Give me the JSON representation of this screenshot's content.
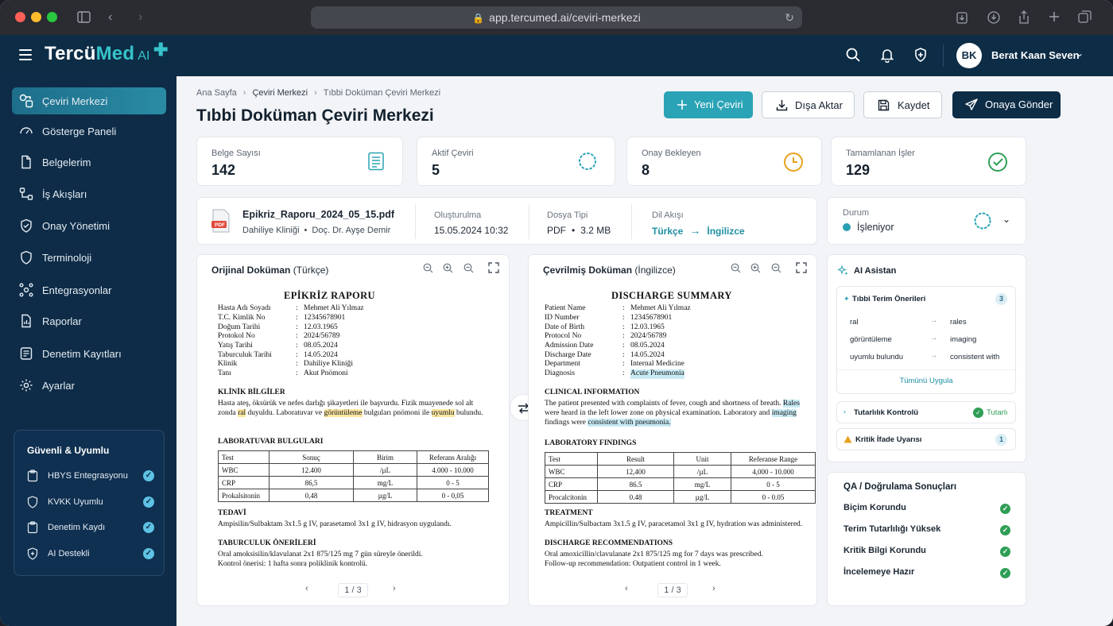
{
  "browser": {
    "url": "app.tercumed.ai/ceviri-merkezi"
  },
  "app": {
    "logo_a": "Tercü",
    "logo_b": "Med",
    "logo_ai": "AI"
  },
  "user": {
    "initials": "BK",
    "name": "Berat Kaan Seven"
  },
  "sidebar": {
    "items": [
      {
        "label": "Çeviri Merkezi",
        "icon": "translate-icon"
      },
      {
        "label": "Gösterge Paneli",
        "icon": "dashboard-icon"
      },
      {
        "label": "Belgelerim",
        "icon": "document-icon"
      },
      {
        "label": "İş Akışları",
        "icon": "workflow-icon"
      },
      {
        "label": "Onay Yönetimi",
        "icon": "shield-check-icon"
      },
      {
        "label": "Terminoloji",
        "icon": "shield-icon"
      },
      {
        "label": "Entegrasyonlar",
        "icon": "integration-icon"
      },
      {
        "label": "Raporlar",
        "icon": "report-icon"
      },
      {
        "label": "Denetim Kayıtları",
        "icon": "audit-icon"
      },
      {
        "label": "Ayarlar",
        "icon": "gear-icon"
      }
    ],
    "secure": {
      "title": "Güvenli & Uyumlu",
      "items": [
        "HBYS Entegrasyonu",
        "KVKK Uyumlu",
        "Denetim Kaydı",
        "AI Destekli"
      ]
    }
  },
  "breadcrumb": {
    "home": "Ana Sayfa",
    "mid": "Çeviri Merkezi",
    "current": "Tıbbi Doküman Çeviri Merkezi"
  },
  "page": {
    "title": "Tıbbi Doküman Çeviri Merkezi"
  },
  "toolbar": {
    "new": "Yeni Çeviri",
    "export": "Dışa Aktar",
    "save": "Kaydet",
    "send": "Onaya Gönder"
  },
  "stats": [
    {
      "label": "Belge Sayısı",
      "value": "142"
    },
    {
      "label": "Aktif Çeviri",
      "value": "5"
    },
    {
      "label": "Onay Bekleyen",
      "value": "8"
    },
    {
      "label": "Tamamlanan İşler",
      "value": "129"
    }
  ],
  "file": {
    "name": "Epikriz_Raporu_2024_05_15.pdf",
    "clinic": "Dahiliye Kliniği",
    "doctor": "Doç. Dr. Ayşe Demir",
    "created_label": "Oluşturulma",
    "created": "15.05.2024 10:32",
    "type_label": "Dosya Tipi",
    "type": "PDF",
    "size": "3.2 MB",
    "lang_label": "Dil Akışı",
    "lang_from": "Türkçe",
    "lang_to": "İngilizce",
    "pdf_tag": "PDF"
  },
  "status": {
    "label": "Durum",
    "value": "İşleniyor"
  },
  "original": {
    "head": "Orijinal Doküman",
    "lang": "(Türkçe)",
    "title": "EPİKRİZ RAPORU",
    "fields": [
      [
        "Hasta Adı Soyadı",
        "Mehmet Ali Yılmaz"
      ],
      [
        "T.C. Kimlik No",
        "12345678901"
      ],
      [
        "Doğum Tarihi",
        "12.03.1965"
      ],
      [
        "Protokol No",
        "2024/56789"
      ],
      [
        "Yatış Tarihi",
        "08.05.2024"
      ],
      [
        "Taburculuk Tarihi",
        "14.05.2024"
      ],
      [
        "Klinik",
        "Dahiliye Kliniği"
      ],
      [
        "Tanı",
        "Akut Pnömoni"
      ]
    ],
    "clin_h": "KLİNİK BİLGİLER",
    "clin_1": "Hasta ateş, öksürük ve nefes darlığı şikayetleri ile başvurdu. Fizik muayenede sol alt zonda ",
    "clin_hl1": "ral",
    "clin_2": " duyuldu. Laboratuvar ve ",
    "clin_hl2": "görüntüleme",
    "clin_3": " bulguları pnömoni ile ",
    "clin_hl3": "uyumlu",
    "clin_4": " bulundu.",
    "lab_h": "LABORATUVAR BULGULARI",
    "lab_cols": [
      "Test",
      "Sonuç",
      "Birim",
      "Referans Aralığı"
    ],
    "lab_rows": [
      [
        "WBC",
        "12.400",
        "/µL",
        "4.000 - 10.000"
      ],
      [
        "CRP",
        "86,5",
        "mg/L",
        "0 - 5"
      ],
      [
        "Prokalsitonin",
        "0,48",
        "µg/L",
        "0 - 0,05"
      ]
    ],
    "tx_h": "TEDAVİ",
    "tx": "Ampisilin/Sulbaktam 3x1.5 g IV, parasetamol 3x1 g IV, hidrasyon uygulandı.",
    "dc_h": "TABURCULUK ÖNERİLERİ",
    "dc_1": "Oral amoksisilin/klavulanat 2x1 875/125 mg 7 gün süreyle önerildi.",
    "dc_2": "Kontrol önerisi: 1 hafta sonra poliklinik kontrolü.",
    "page": "1 / 3"
  },
  "translated": {
    "head": "Çevrilmiş Doküman",
    "lang": "(İngilizce)",
    "title": "DISCHARGE SUMMARY",
    "fields": [
      [
        "Patient Name",
        "Mehmet Ali Yılmaz"
      ],
      [
        "ID Number",
        "12345678901"
      ],
      [
        "Date of Birth",
        "12.03.1965"
      ],
      [
        "Protocol No",
        "2024/56789"
      ],
      [
        "Admission Date",
        "08.05.2024"
      ],
      [
        "Discharge Date",
        "14.05.2024"
      ],
      [
        "Department",
        "Internal Medicine"
      ],
      [
        "Diagnosis",
        "Acute Pneumonia"
      ]
    ],
    "clin_h": "CLINICAL INFORMATION",
    "clin_1": "The patient presented with complaints of fever, cough and shortness of breath. ",
    "clin_hl1": "Rales",
    "clin_2": " were heard in the left lower zone on physical examination. Laboratory and ",
    "clin_hl2": "imaging",
    "clin_3": " findings were ",
    "clin_hl3": "consistent with pneumonia.",
    "lab_h": "LABORATORY FINDINGS",
    "lab_cols": [
      "Test",
      "Result",
      "Unit",
      "Referanse Range"
    ],
    "lab_rows": [
      [
        "WBC",
        "12,400",
        "/µL",
        "4,000 - 10.000"
      ],
      [
        "CRP",
        "86.5",
        "mg/L",
        "0 - 5"
      ],
      [
        "Procalcitonin",
        "0.48",
        "µg/L",
        "0 - 0.05"
      ]
    ],
    "tx_h": "TREATMENT",
    "tx": "Ampicillin/Sulbactam 3x1.5 g IV, paracetamol 3x1 g IV, hydration was administered.",
    "dc_h": "DISCHARGE RECOMMENDATIONS",
    "dc_1": "Oral amoxicillin/clavulanate 2x1 875/125 mg for 7 days was prescribed.",
    "dc_2": "Follow-up recommendation: Outpatient control in 1 week.",
    "page": "1 / 3"
  },
  "assistant": {
    "title": "AI Asistan",
    "terms_title": "Tıbbi Terim Önerileri",
    "terms_count": "3",
    "terms": [
      [
        "ral",
        "rales"
      ],
      [
        "görüntüleme",
        "imaging"
      ],
      [
        "uyumlu bulundu",
        "consistent with"
      ]
    ],
    "apply_all": "Tümünü Uygula",
    "consistency": "Tutarlılık Kontrolü",
    "consistency_status": "Tutarlı",
    "critical": "Kritik İfade Uyarısı",
    "critical_count": "1"
  },
  "qa": {
    "title": "QA / Doğrulama Sonuçları",
    "items": [
      "Biçim Korundu",
      "Terim Tutarlılığı Yüksek",
      "Kritik Bilgi Korundu",
      "İncelemeye Hazır"
    ]
  },
  "colors": {
    "accent": "#2aa3b6",
    "navy": "#0e2c47",
    "success": "#2e9e55",
    "warning": "#e8a11d"
  }
}
